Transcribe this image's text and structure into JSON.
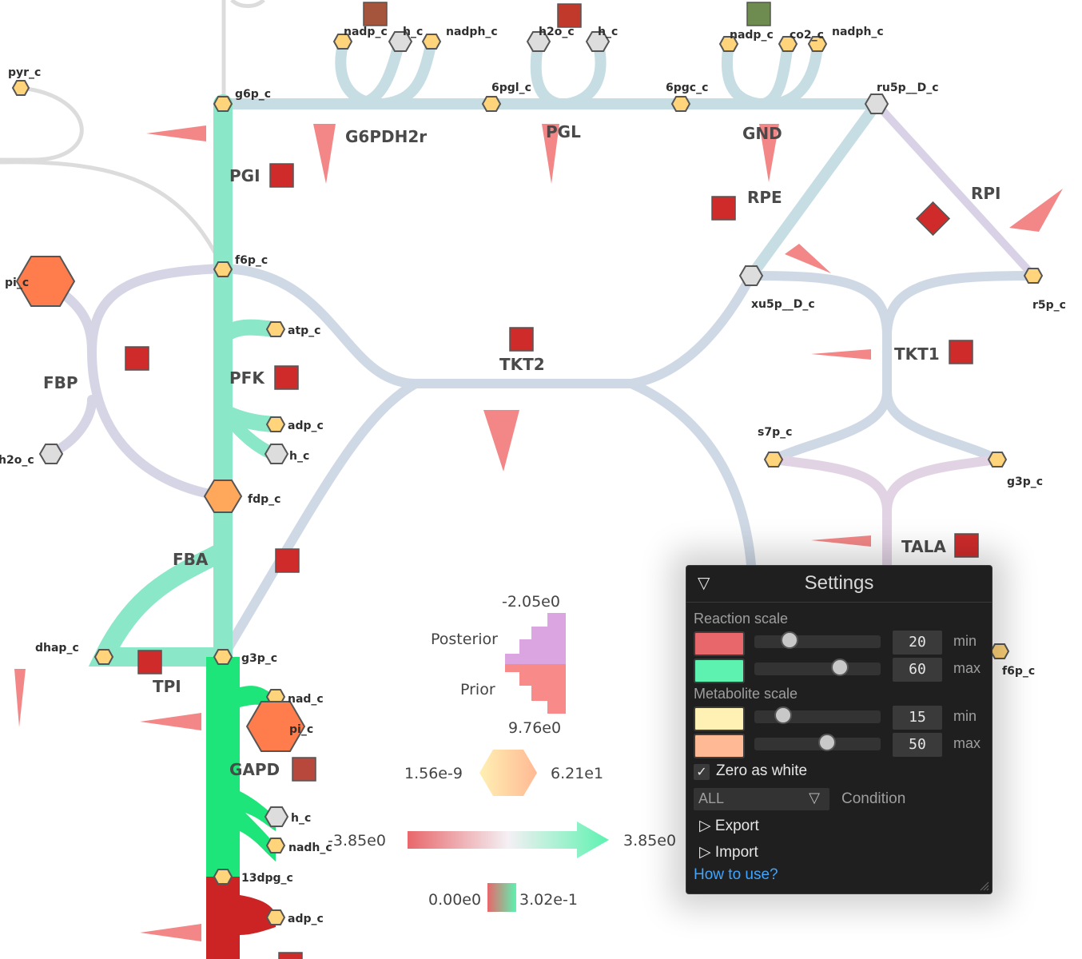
{
  "reactions": {
    "G6PDH2r": "G6PDH2r",
    "PGL": "PGL",
    "GND": "GND",
    "RPE": "RPE",
    "RPI": "RPI",
    "PGI": "PGI",
    "PFK": "PFK",
    "FBP": "FBP",
    "FBA": "FBA",
    "TPI": "TPI",
    "GAPD": "GAPD",
    "TKT1": "TKT1",
    "TKT2": "TKT2",
    "TALA": "TALA"
  },
  "metabolites": {
    "pyr_c": "pyr_c",
    "g6p_c": "g6p_c",
    "f6p_c": "f6p_c",
    "pi_c": "pi_c",
    "h2o_c": "h2o_c",
    "atp_c": "atp_c",
    "adp_c": "adp_c",
    "h_c": "h_c",
    "fdp_c": "fdp_c",
    "dhap_c": "dhap_c",
    "g3p_c": "g3p_c",
    "nad_c": "nad_c",
    "nadh_c": "nadh_c",
    "13dpg_c": "13dpg_c",
    "nadp_c": "nadp_c",
    "nadph_c": "nadph_c",
    "h2o_c_pgl": "h2o_c",
    "6pgl_c": "6pgl_c",
    "6pgc_c": "6pgc_c",
    "co2_c": "co2_c",
    "ru5p__D_c": "ru5p__D_c",
    "xu5p__D_c": "xu5p__D_c",
    "r5p_c": "r5p_c",
    "s7p_c": "s7p_c",
    "f6p_c_right": "f6p_c"
  },
  "legend": {
    "posterior_label": "Posterior",
    "prior_label": "Prior",
    "hist_top": "-2.05e0",
    "hist_bottom": "9.76e0",
    "met_min": "1.56e-9",
    "met_max": "6.21e1",
    "flux_min": "-3.85e0",
    "flux_max": "3.85e0",
    "cv_min": "0.00e0",
    "cv_max": "3.02e-1"
  },
  "settings": {
    "title": "Settings",
    "collapse_icon": "▽",
    "reaction_scale_label": "Reaction scale",
    "metabolite_scale_label": "Metabolite scale",
    "reaction_min": {
      "color": "#e8676b",
      "value": "20",
      "label": "min",
      "slider_fraction": 0.2
    },
    "reaction_max": {
      "color": "#5df2b0",
      "value": "60",
      "label": "max",
      "slider_fraction": 0.6
    },
    "metabolite_min": {
      "color": "#fff0b3",
      "value": "15",
      "label": "min",
      "slider_fraction": 0.15
    },
    "metabolite_max": {
      "color": "#ffb994",
      "value": "50",
      "label": "max",
      "slider_fraction": 0.5
    },
    "zero_as_white": {
      "label": "Zero as white",
      "checked": true,
      "mark": "✓"
    },
    "condition": {
      "selected": "ALL",
      "label": "Condition"
    },
    "export_label": "Export",
    "import_label": "Import",
    "tree_arrow": "▷",
    "help_link": "How to use?"
  }
}
